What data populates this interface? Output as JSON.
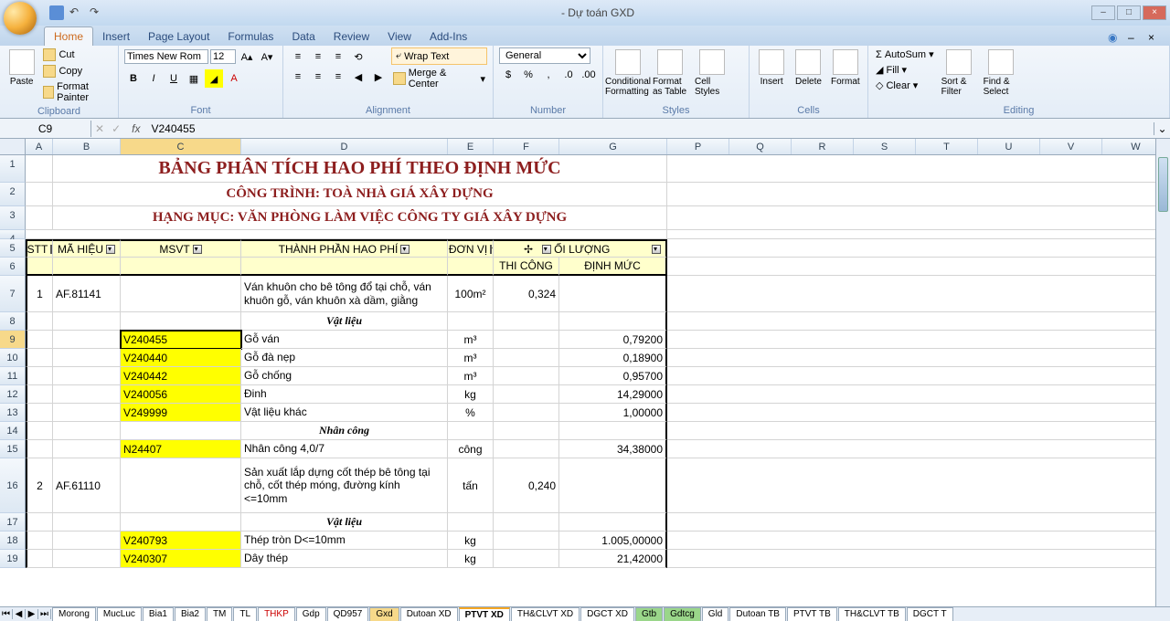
{
  "title": "- Dự toán GXD",
  "tabs": [
    "Home",
    "Insert",
    "Page Layout",
    "Formulas",
    "Data",
    "Review",
    "View",
    "Add-Ins"
  ],
  "activeTab": 0,
  "clipboard": {
    "paste": "Paste",
    "cut": "Cut",
    "copy": "Copy",
    "fmt": "Format Painter",
    "label": "Clipboard"
  },
  "font": {
    "name": "Times New Rom",
    "size": "12",
    "label": "Font"
  },
  "alignment": {
    "wrap": "Wrap Text",
    "merge": "Merge & Center",
    "label": "Alignment"
  },
  "number": {
    "format": "General",
    "label": "Number"
  },
  "styles": {
    "cond": "Conditional Formatting",
    "fmtTable": "Format as Table",
    "cellStyles": "Cell Styles",
    "label": "Styles"
  },
  "cells": {
    "insert": "Insert",
    "delete": "Delete",
    "format": "Format",
    "label": "Cells"
  },
  "editing": {
    "autosum": "AutoSum",
    "fill": "Fill",
    "clear": "Clear",
    "sort": "Sort & Filter",
    "find": "Find & Select",
    "label": "Editing"
  },
  "cellRef": "C9",
  "cellVal": "V240455",
  "cols": [
    "A",
    "B",
    "C",
    "D",
    "E",
    "F",
    "G",
    "P",
    "Q",
    "R",
    "S",
    "T",
    "U",
    "V",
    "W"
  ],
  "header1": "BẢNG PHÂN TÍCH HAO PHÍ THEO ĐỊNH MỨC",
  "header2": "CÔNG TRÌNH: TOÀ NHÀ GIÁ XÂY DỰNG",
  "header3": "HẠNG MỤC: VĂN PHÒNG LÀM VIỆC CÔNG TY GIÁ XÂY DỰNG",
  "th": {
    "stt": "STT",
    "mahieu": "MÃ HIỆU",
    "msvt": "MSVT",
    "thanhphan": "THÀNH PHẦN HAO PHÍ",
    "donvi": "ĐƠN VỊ",
    "oiluong": "ỐI LƯỢNG",
    "thicong": "THI CÔNG",
    "dinhmuc": "ĐỊNH MỨC"
  },
  "rows": [
    {
      "n": "7",
      "a": "1",
      "b": "AF.81141",
      "d": "Ván khuôn cho bê tông đổ tại chỗ, ván khuôn gỗ, ván khuôn xà dầm, giằng",
      "e": "100m²",
      "f": "0,324",
      "tall": true
    },
    {
      "n": "8",
      "d": "Vật liệu",
      "section": true
    },
    {
      "n": "9",
      "c": "V240455",
      "d": "Gỗ ván",
      "e": "m³",
      "g": "0,79200",
      "y": true,
      "sel": true
    },
    {
      "n": "10",
      "c": "V240440",
      "d": "Gỗ đà nẹp",
      "e": "m³",
      "g": "0,18900",
      "y": true
    },
    {
      "n": "11",
      "c": "V240442",
      "d": "Gỗ chống",
      "e": "m³",
      "g": "0,95700",
      "y": true
    },
    {
      "n": "12",
      "c": "V240056",
      "d": "Đinh",
      "e": "kg",
      "g": "14,29000",
      "y": true
    },
    {
      "n": "13",
      "c": "V249999",
      "d": "Vật liệu khác",
      "e": "%",
      "g": "1,00000",
      "y": true
    },
    {
      "n": "14",
      "d": "Nhân công",
      "section": true
    },
    {
      "n": "15",
      "c": "N24407",
      "d": "Nhân công 4,0/7",
      "e": "công",
      "g": "34,38000",
      "y": true
    },
    {
      "n": "16",
      "a": "2",
      "b": "AF.61110",
      "d": "Sản xuất lắp dựng cốt thép bê tông tại chỗ, cốt thép móng, đường kính <=10mm",
      "e": "tấn",
      "f": "0,240",
      "vtall": true
    },
    {
      "n": "17",
      "d": "Vật liệu",
      "section": true
    },
    {
      "n": "18",
      "c": "V240793",
      "d": "Thép tròn D<=10mm",
      "e": "kg",
      "g": "1.005,00000",
      "y": true
    },
    {
      "n": "19",
      "c": "V240307",
      "d": "Dây thép",
      "e": "kg",
      "g": "21,42000",
      "y": true
    }
  ],
  "sheets": [
    "Morong",
    "MucLuc",
    "Bia1",
    "Bia2",
    "TM",
    "TL",
    "THKP",
    "Gdp",
    "QD957",
    "Gxd",
    "Dutoan XD",
    "PTVT XD",
    "TH&CLVT XD",
    "DGCT XD",
    "Gtb",
    "Gdtcg",
    "Gld",
    "Dutoan TB",
    "PTVT TB",
    "TH&CLVT TB",
    "DGCT T"
  ],
  "activeSheet": 11
}
